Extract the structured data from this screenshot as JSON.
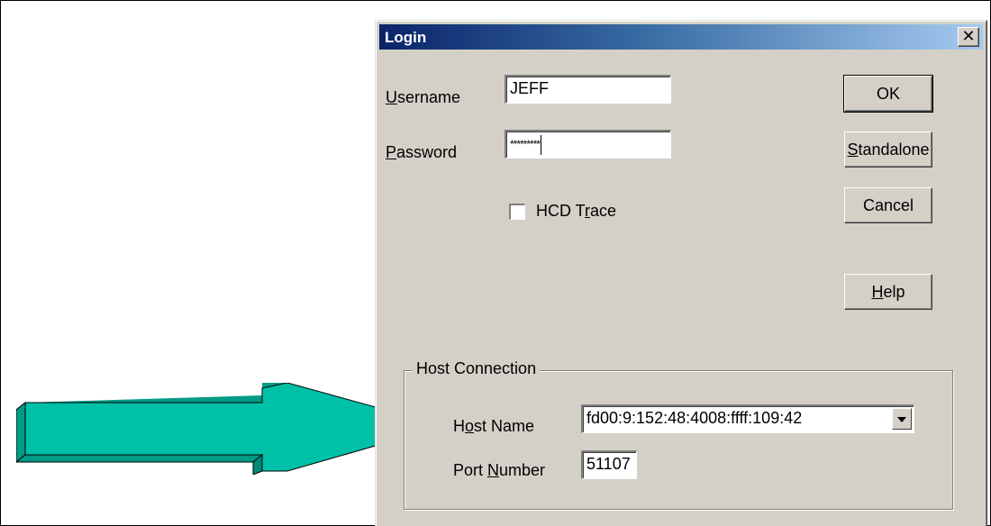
{
  "window": {
    "title": "Login",
    "close_glyph": "✕"
  },
  "form": {
    "username": {
      "label_pre": "",
      "label_u": "U",
      "label_post": "sername",
      "value": "JEFF"
    },
    "password": {
      "label_pre": "",
      "label_u": "P",
      "label_post": "assword",
      "masked_value": "*********"
    },
    "trace": {
      "label_pre": "HCD T",
      "label_u": "r",
      "label_post": "ace",
      "checked": false
    }
  },
  "buttons": {
    "ok": {
      "pre": "OK",
      "u": "",
      "post": ""
    },
    "standalone": {
      "pre": "",
      "u": "S",
      "post": "tandalone"
    },
    "cancel": {
      "pre": "Cancel",
      "u": "",
      "post": ""
    },
    "help": {
      "pre": "",
      "u": "H",
      "post": "elp"
    }
  },
  "host_connection": {
    "group_title": "Host Connection",
    "host_name": {
      "label_pre": "H",
      "label_u": "o",
      "label_post": "st Name",
      "value": "fd00:9:152:48:4008:ffff:109:42"
    },
    "port_number": {
      "label_pre": "Port ",
      "label_u": "N",
      "label_post": "umber",
      "value": "51107"
    }
  },
  "annotation": {
    "arrow_icon": "arrow-right-icon",
    "arrow_color": "#00c0a8"
  }
}
